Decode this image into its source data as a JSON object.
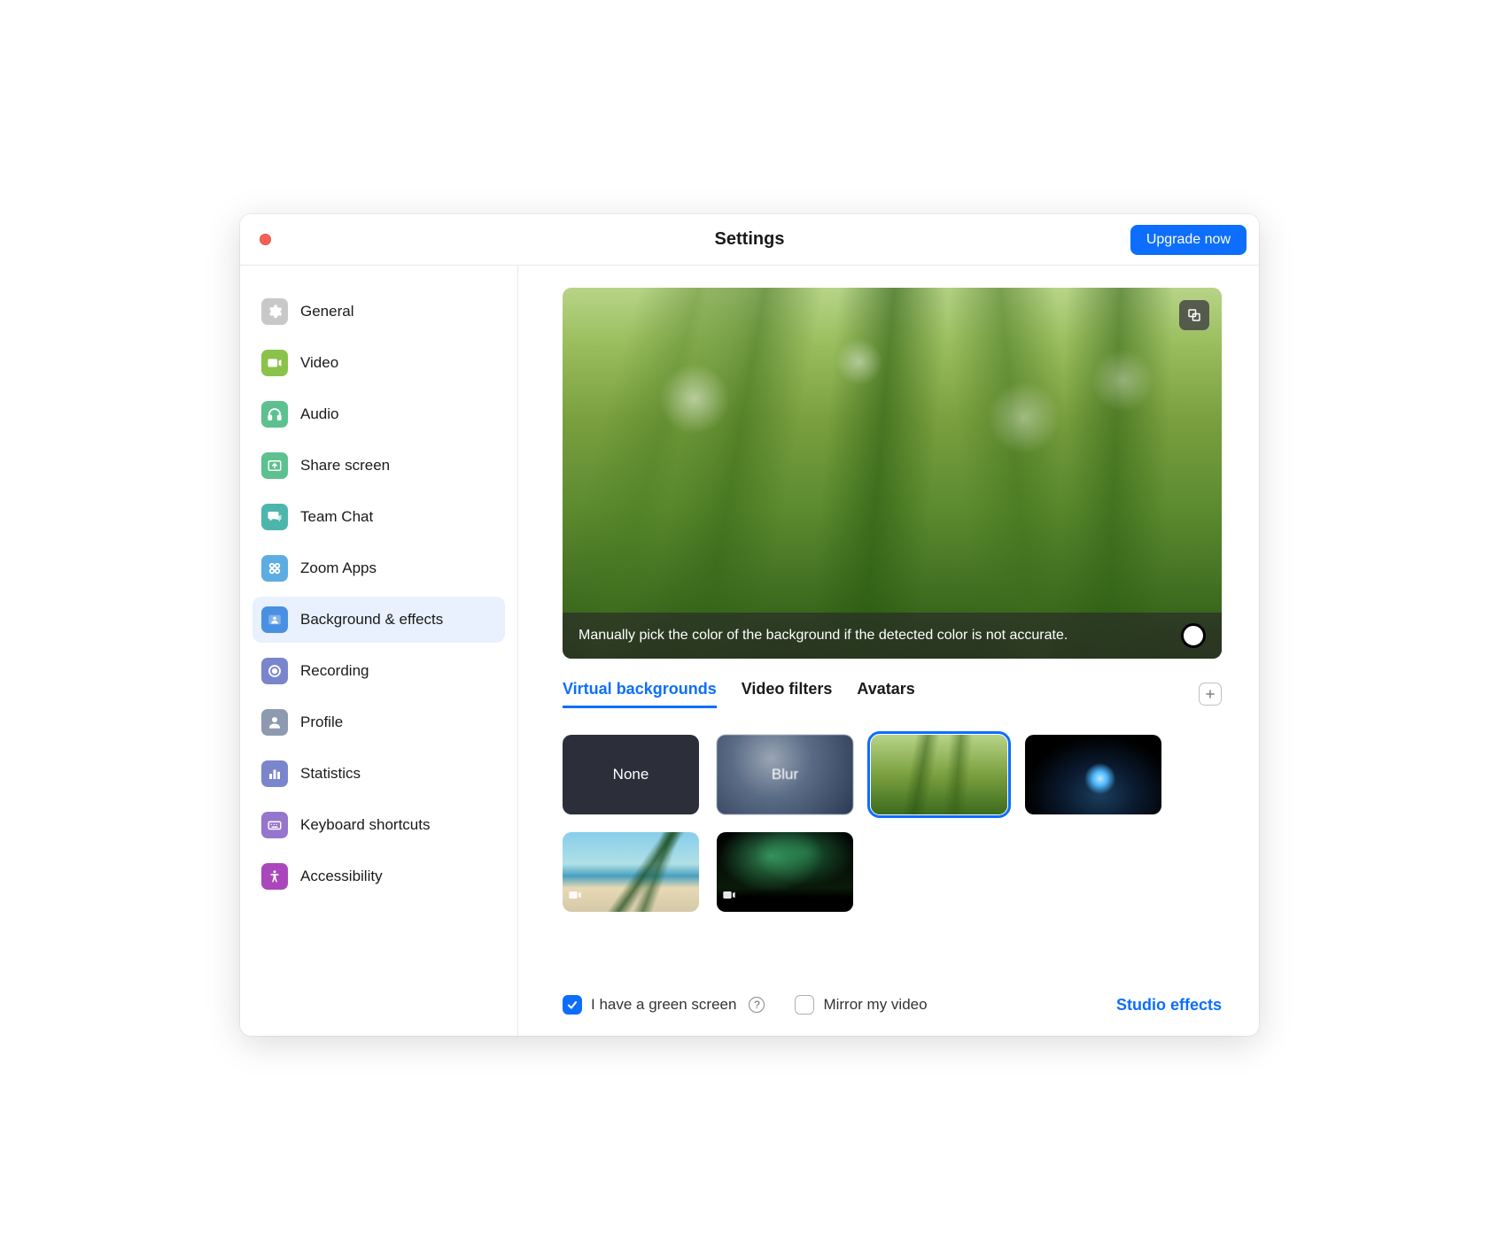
{
  "window": {
    "title": "Settings",
    "upgrade_label": "Upgrade now"
  },
  "sidebar": {
    "items": [
      {
        "label": "General"
      },
      {
        "label": "Video"
      },
      {
        "label": "Audio"
      },
      {
        "label": "Share screen"
      },
      {
        "label": "Team Chat"
      },
      {
        "label": "Zoom Apps"
      },
      {
        "label": "Background & effects"
      },
      {
        "label": "Recording"
      },
      {
        "label": "Profile"
      },
      {
        "label": "Statistics"
      },
      {
        "label": "Keyboard shortcuts"
      },
      {
        "label": "Accessibility"
      }
    ],
    "active_index": 6
  },
  "preview": {
    "caption": "Manually pick the color of the background if the detected color is not accurate."
  },
  "tabs": [
    {
      "label": "Virtual backgrounds"
    },
    {
      "label": "Video filters"
    },
    {
      "label": "Avatars"
    }
  ],
  "active_tab": 0,
  "thumbnails": {
    "none_label": "None",
    "blur_label": "Blur"
  },
  "footer": {
    "green_screen_label": "I have a green screen",
    "green_screen_checked": true,
    "mirror_label": "Mirror my video",
    "mirror_checked": false,
    "studio_label": "Studio effects"
  }
}
